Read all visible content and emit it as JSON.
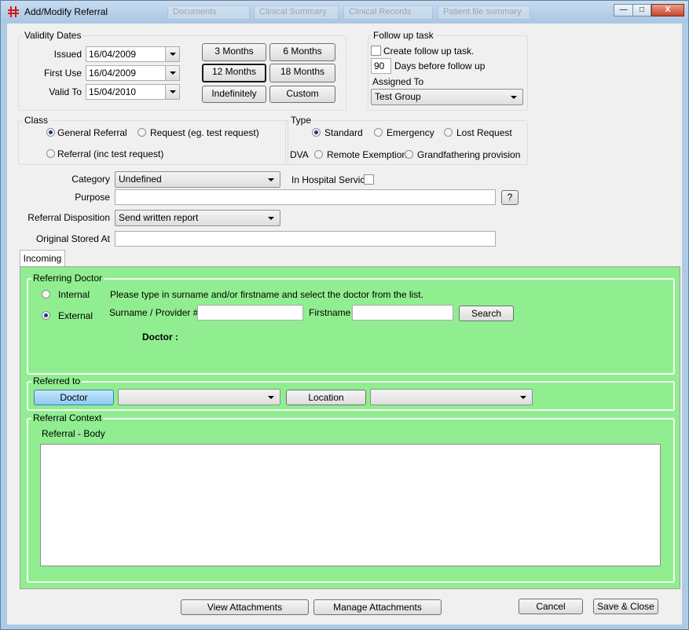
{
  "window": {
    "title": "Add/Modify Referral",
    "background_tabs": [
      "Documents",
      "Clinical Summary",
      "Clinical Records",
      "Patient file summary"
    ],
    "controls": {
      "minimize": "—",
      "maximize": "□",
      "close": "X"
    }
  },
  "validity_dates": {
    "group_label": "Validity Dates",
    "issued_label": "Issued",
    "issued_value": "16/04/2009",
    "first_use_label": "First Use",
    "first_use_value": "16/04/2009",
    "valid_to_label": "Valid To",
    "valid_to_value": "15/04/2010",
    "period_buttons": [
      "3 Months",
      "6 Months",
      "12 Months",
      "18 Months",
      "Indefinitely",
      "Custom"
    ],
    "selected_period": "12 Months"
  },
  "follow_up": {
    "group_label": "Follow up task",
    "create_task_label": "Create follow up task.",
    "create_task_checked": false,
    "days_value": "90",
    "days_label": "Days before follow up",
    "assigned_to_label": "Assigned To",
    "assigned_to_value": "Test Group"
  },
  "class": {
    "group_label": "Class",
    "options": [
      "General Referral",
      "Request (eg. test request)",
      "Referral (inc test request)"
    ],
    "selected": "General Referral"
  },
  "type": {
    "group_label": "Type",
    "options": [
      "Standard",
      "Emergency",
      "Lost Request"
    ],
    "selected": "Standard",
    "dva_label": "DVA",
    "dva_options": [
      "Remote Exemption",
      "Grandfathering provision"
    ]
  },
  "form": {
    "category_label": "Category",
    "category_value": "Undefined",
    "in_hospital_label": "In Hospital Service",
    "in_hospital_checked": false,
    "purpose_label": "Purpose",
    "purpose_value": "",
    "help_button": "?",
    "disposition_label": "Referral Disposition",
    "disposition_value": "Send written report",
    "stored_at_label": "Original Stored At",
    "stored_at_value": ""
  },
  "tabs": [
    {
      "label": "Incoming",
      "active": true
    }
  ],
  "referring_doctor": {
    "group_label": "Referring Doctor",
    "internal_label": "Internal",
    "external_label": "External",
    "selected": "External",
    "instructions": "Please type in surname and/or firstname and select the doctor from the list.",
    "surname_label": "Surname / Provider #",
    "surname_value": "",
    "firstname_label": "Firstname",
    "firstname_value": "",
    "search_button": "Search",
    "doctor_label": "Doctor :"
  },
  "referred_to": {
    "group_label": "Referred to",
    "doctor_button": "Doctor",
    "doctor_combo_value": "",
    "location_button": "Location",
    "location_combo_value": ""
  },
  "referral_context": {
    "group_label": "Referral Context",
    "body_label": "Referral - Body",
    "body_value": ""
  },
  "footer": {
    "view_attachments": "View Attachments",
    "manage_attachments": "Manage Attachments",
    "cancel": "Cancel",
    "save_close": "Save & Close"
  },
  "colors": {
    "panel_green": "#90ee90",
    "selected_radio": "#1c3c6c",
    "highlight_button": "#8cc9f2"
  }
}
